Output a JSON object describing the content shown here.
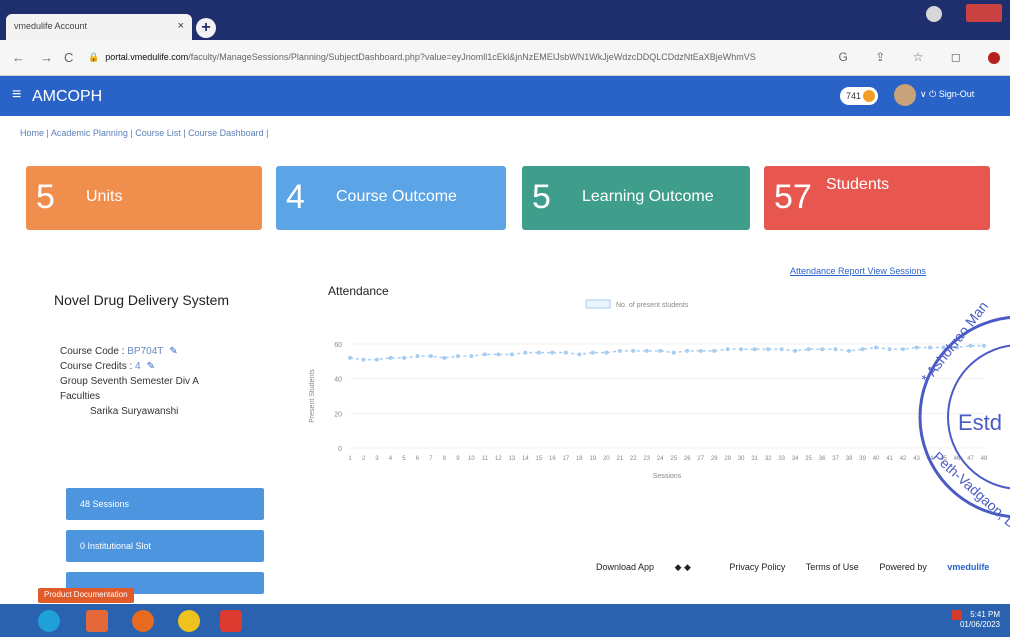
{
  "browser": {
    "tab_title": "vmedulife Account",
    "tab_close": "×",
    "new_tab": "+",
    "url_host": "portal.vmedulife.com",
    "url_path": "/faculty/ManageSessions/Planning/SubjectDashboard.php?value=eyJnomll1cEkl&jnNzEMEIJsbWN1WkJjeWdzcDDQLCDdzNtEaXBjeWhmVS",
    "back": "←",
    "forward": "→",
    "reload": "C",
    "lock": "🔒",
    "toolbar_icons": "G ⇪ ☆ ◻"
  },
  "app": {
    "menu_icon": "≡",
    "brand": "AMCOPH",
    "coins": "741",
    "user_menu": "∨ ⏻ Sign-Out"
  },
  "breadcrumb": "Home | Academic Planning | Course List | Course Dashboard |",
  "cards": {
    "units": {
      "num": "5",
      "label": "Units"
    },
    "co": {
      "num": "4",
      "label": "Course Outcome"
    },
    "lo": {
      "num": "5",
      "label": "Learning Outcome"
    },
    "students": {
      "num": "57",
      "label": "Students"
    }
  },
  "subject": {
    "title": "Novel Drug Delivery System",
    "code_label": "Course Code : ",
    "code_value": "BP704T",
    "credits_label": "Course Credits : ",
    "credits_value": "4",
    "group": "Group   Seventh Semester Div A",
    "faculties_label": "Faculties",
    "faculty_name": "Sarika Suryawanshi",
    "edit_icon": "✎"
  },
  "side_buttons": [
    "48 Sessions",
    "0 Institutional Slot",
    ""
  ],
  "attendance": {
    "title": "Attendance",
    "links": "Attendance Report   View Sessions"
  },
  "chart_data": {
    "type": "line",
    "title": "",
    "xlabel": "Sessions",
    "ylabel": "Present Students",
    "ylim": [
      0,
      60
    ],
    "yticks": [
      0,
      20,
      40,
      60
    ],
    "x": [
      1,
      2,
      3,
      4,
      5,
      6,
      7,
      8,
      9,
      10,
      11,
      12,
      13,
      14,
      15,
      16,
      17,
      18,
      19,
      20,
      21,
      22,
      23,
      24,
      25,
      26,
      27,
      28,
      29,
      30,
      31,
      32,
      33,
      34,
      35,
      36,
      37,
      38,
      39,
      40,
      41,
      42,
      43,
      44,
      45,
      46,
      47,
      48
    ],
    "series": [
      {
        "name": "No. of present students",
        "color": "#a7cdf0",
        "values": [
          52,
          51,
          51,
          52,
          52,
          53,
          53,
          52,
          53,
          53,
          54,
          54,
          54,
          55,
          55,
          55,
          55,
          54,
          55,
          55,
          56,
          56,
          56,
          56,
          55,
          56,
          56,
          56,
          57,
          57,
          57,
          57,
          57,
          56,
          57,
          57,
          57,
          56,
          57,
          58,
          57,
          57,
          58,
          58,
          58,
          58,
          59,
          59
        ]
      }
    ]
  },
  "footer": {
    "download": "Download App",
    "download_icons": "◆ ◆",
    "privacy": "Privacy Policy",
    "terms": "Terms of Use",
    "powered": "Powered by",
    "powered_brand": "vmedulife"
  },
  "taskbar": {
    "doc_tag": "Product Documentation",
    "time": "5:41 PM",
    "date": "01/06/2023"
  },
  "stamp": {
    "text_top": "* Ashokrao Man",
    "text_mid": "Estd",
    "text_bot": "Peth-Vadgaon, D",
    "color": "#4a5bc4"
  }
}
